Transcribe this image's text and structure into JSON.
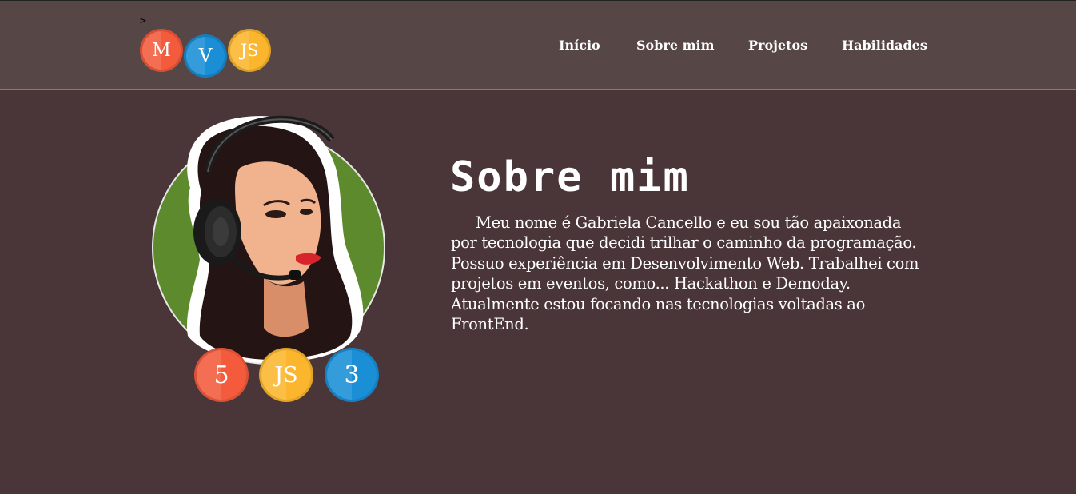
{
  "header": {
    "caret": ">",
    "logo": [
      {
        "letter": "M",
        "color": "#f35b3c"
      },
      {
        "letter": "V",
        "color": "#1a8fd6"
      },
      {
        "letter": "JS",
        "color": "#fbb62d"
      }
    ],
    "nav": [
      "Início",
      "Sobre mim",
      "Projetos",
      "Habilidades"
    ]
  },
  "main": {
    "title": "Sobre mim",
    "about": "Meu nome é Gabriela Cancello e eu sou tão apaixonada por tecnologia que decidi trilhar o caminho da programação. Possuo experiência em Desenvolvimento Web. Trabalhei com projetos em eventos, como... Hackathon e Demoday. Atualmente estou focando nas tecnologias voltadas ao FrontEnd.",
    "avatar_bg": "#5e8a2e",
    "skills": [
      {
        "label": "5",
        "name": "html5-icon",
        "color": "#f35b3c"
      },
      {
        "label": "JS",
        "name": "javascript-icon",
        "color": "#fbb62d"
      },
      {
        "label": "3",
        "name": "css3-icon",
        "color": "#1a8fd6"
      }
    ]
  },
  "colors": {
    "page_bg": "#4a3638",
    "header_bg": "#574646"
  }
}
